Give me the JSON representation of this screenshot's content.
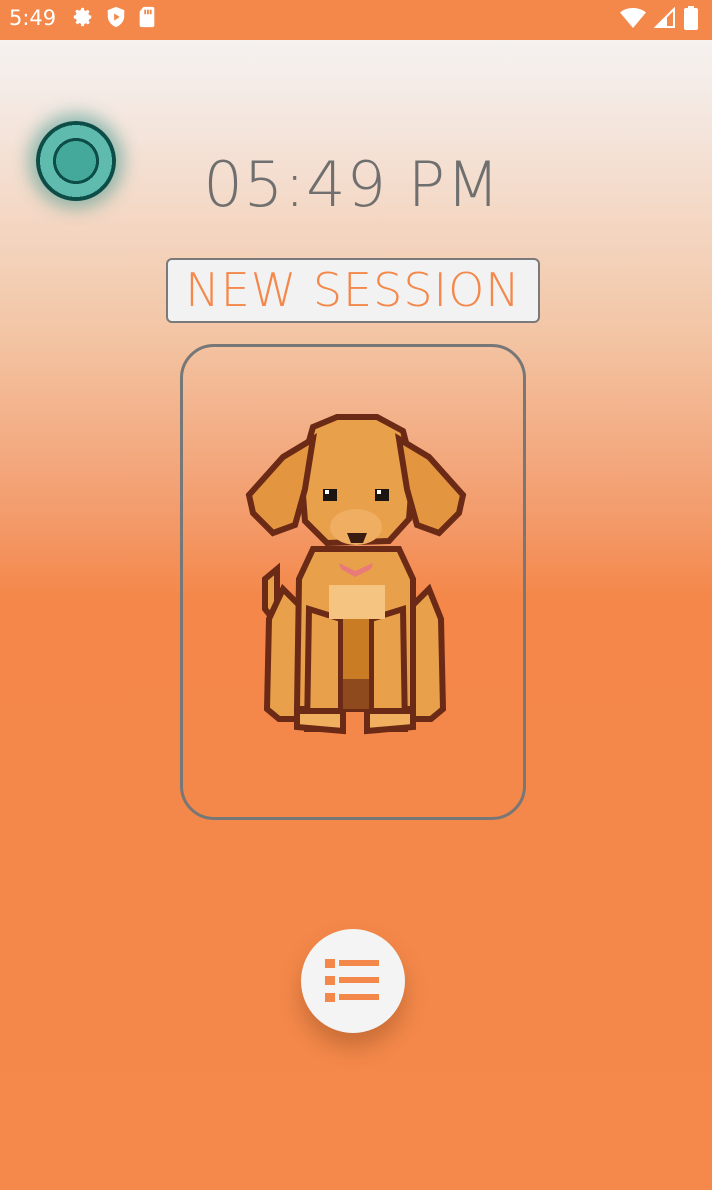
{
  "status_bar": {
    "time": "5:49",
    "left_icons": [
      "gear-icon",
      "shield-play-icon",
      "sd-card-icon"
    ],
    "right_icons": [
      "wifi-icon",
      "signal-icon",
      "battery-icon"
    ],
    "background": "#f4874a"
  },
  "main": {
    "clock": "05:49 PM",
    "new_session_label": "NEW SESSION",
    "pet_image": "pixel-dog-puppy",
    "menu_button_icon": "list-icon"
  },
  "colors": {
    "accent": "#f4874a",
    "teal": "#44a99b",
    "clock_text": "#6f6f6f"
  }
}
